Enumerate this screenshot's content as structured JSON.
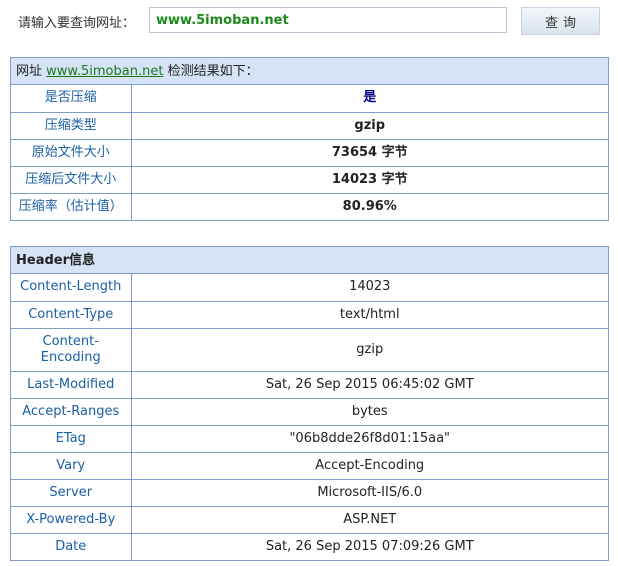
{
  "search": {
    "label": "请输入要查询网址：",
    "value": "www.5imoban.net",
    "button": "查询"
  },
  "result": {
    "title_prefix": "网址",
    "title_url": "www.5imoban.net",
    "title_suffix": "检测结果如下：",
    "rows": [
      {
        "label": "是否压缩",
        "value": "是"
      },
      {
        "label": "压缩类型",
        "value": "gzip"
      },
      {
        "label": "原始文件大小",
        "value": "73654 字节"
      },
      {
        "label": "压缩后文件大小",
        "value": "14023 字节"
      },
      {
        "label": "压缩率（估计值）",
        "value": "80.96%"
      }
    ]
  },
  "headers": {
    "title": "Header信息",
    "rows": [
      {
        "label": "Content-Length",
        "value": "14023"
      },
      {
        "label": "Content-Type",
        "value": "text/html"
      },
      {
        "label": "Content-Encoding",
        "value": "gzip"
      },
      {
        "label": "Last-Modified",
        "value": "Sat, 26 Sep 2015 06:45:02 GMT"
      },
      {
        "label": "Accept-Ranges",
        "value": "bytes"
      },
      {
        "label": "ETag",
        "value": "\"06b8dde26f8d01:15aa\""
      },
      {
        "label": "Vary",
        "value": "Accept-Encoding"
      },
      {
        "label": "Server",
        "value": "Microsoft-IIS/6.0"
      },
      {
        "label": "X-Powered-By",
        "value": "ASP.NET"
      },
      {
        "label": "Date",
        "value": "Sat, 26 Sep 2015 07:09:26 GMT"
      }
    ]
  }
}
